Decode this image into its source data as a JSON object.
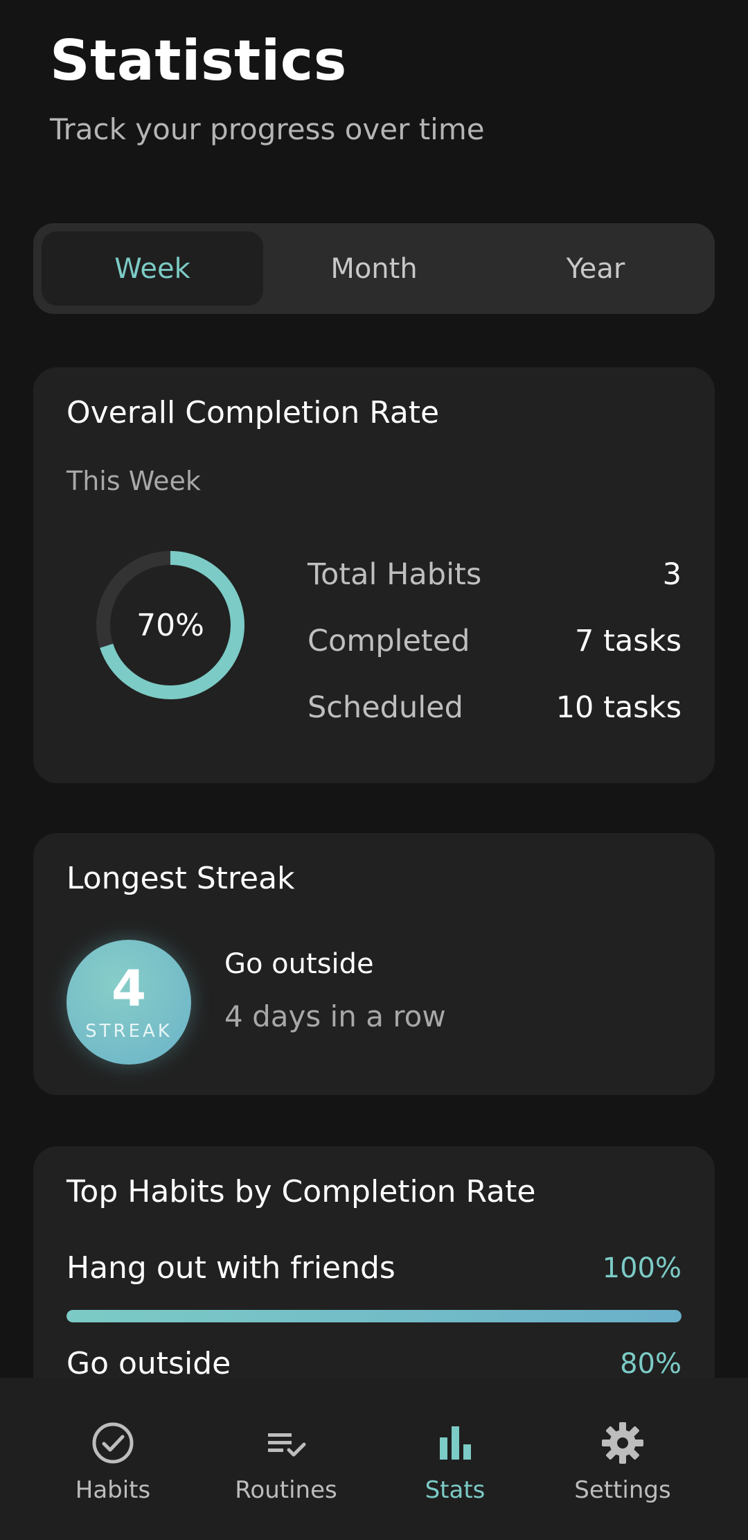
{
  "header": {
    "title": "Statistics",
    "subtitle": "Track your progress over time"
  },
  "period_tabs": [
    {
      "label": "Week",
      "active": true
    },
    {
      "label": "Month",
      "active": false
    },
    {
      "label": "Year",
      "active": false
    }
  ],
  "overall": {
    "title": "Overall Completion Rate",
    "period": "This Week",
    "percent_label": "70%",
    "percent_value": 70,
    "stats": [
      {
        "label": "Total Habits",
        "value": "3"
      },
      {
        "label": "Completed",
        "value": "7 tasks"
      },
      {
        "label": "Scheduled",
        "value": "10 tasks"
      }
    ]
  },
  "streak": {
    "title": "Longest Streak",
    "count": "4",
    "badge_label": "STREAK",
    "habit": "Go outside",
    "detail": "4 days in a row"
  },
  "top_habits": {
    "title": "Top Habits by Completion Rate",
    "items": [
      {
        "name": "Hang out with friends",
        "percent_label": "100%",
        "percent": 100
      },
      {
        "name": "Go outside",
        "percent_label": "80%",
        "percent": 80
      }
    ]
  },
  "nav": {
    "items": [
      {
        "label": "Habits",
        "icon": "check-circle-icon",
        "active": false
      },
      {
        "label": "Routines",
        "icon": "list-check-icon",
        "active": false
      },
      {
        "label": "Stats",
        "icon": "bar-chart-icon",
        "active": true
      },
      {
        "label": "Settings",
        "icon": "gear-icon",
        "active": false
      }
    ]
  },
  "colors": {
    "accent": "#7ccbc6",
    "background": "#141414",
    "card": "#212121",
    "track": "#333333"
  }
}
